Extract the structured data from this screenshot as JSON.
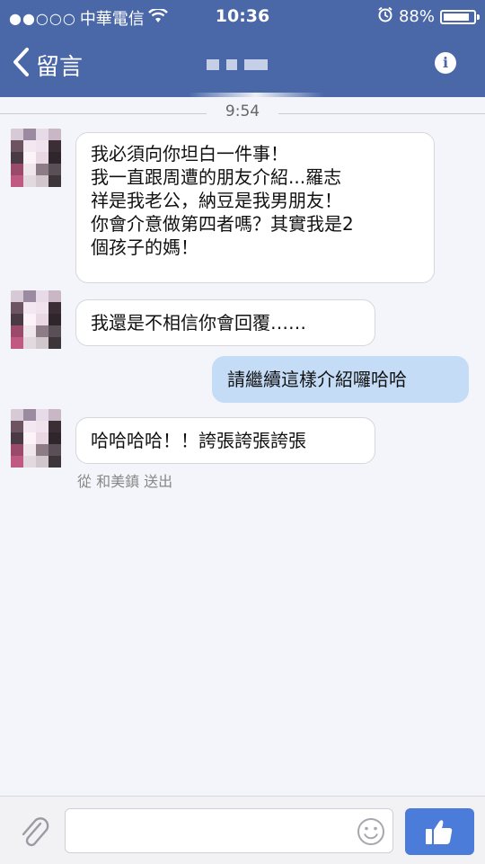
{
  "status_bar": {
    "signal": "●●○○○",
    "carrier": "中華電信",
    "time": "10:36",
    "battery": "88%",
    "battery_level": 0.88
  },
  "nav": {
    "back_label": "留言"
  },
  "timestamp": "9:54",
  "messages": [
    {
      "from": "other",
      "lines": [
        "我必須向你坦白一件事！",
        "我一直跟周遭的朋友介紹...羅志",
        "祥是我老公，納豆是我男朋友！",
        "你會介意做第四者嗎？其實我是2",
        "個孩子的媽！"
      ]
    },
    {
      "from": "other",
      "lines": [
        "我還是不相信你會回覆……"
      ]
    },
    {
      "from": "me",
      "lines": [
        "請繼續這樣介紹囉哈哈"
      ]
    },
    {
      "from": "other",
      "lines": [
        "哈哈哈哈！！誇張誇張誇張"
      ]
    }
  ],
  "sent_from": "從 和美鎮 送出",
  "colors": {
    "header": "#4a67a8",
    "my_bubble": "#c5dcf7",
    "like_button": "#4c7cd9"
  }
}
